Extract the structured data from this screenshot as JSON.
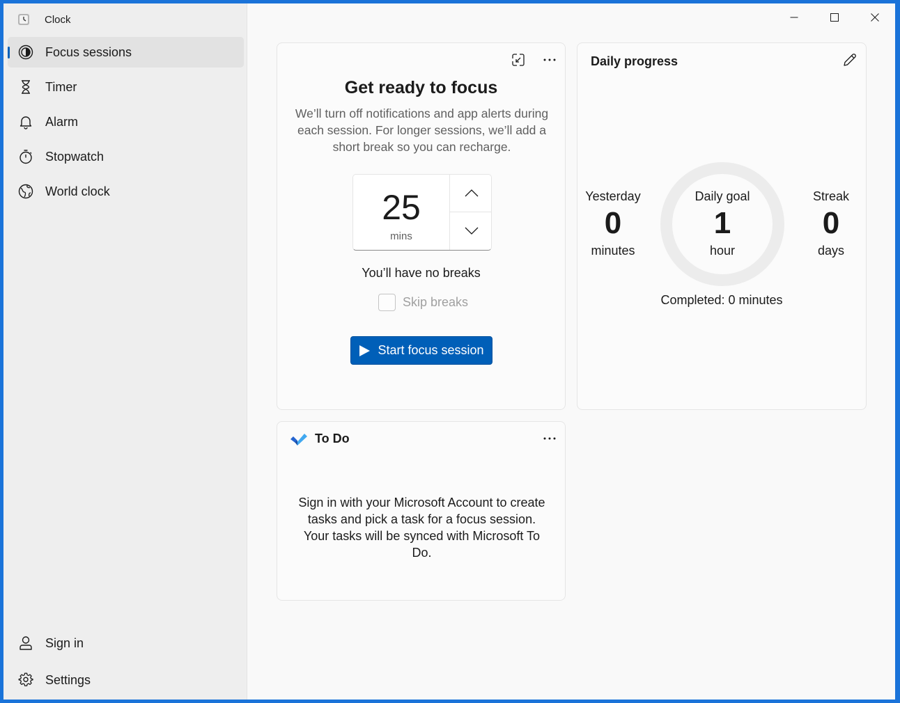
{
  "window": {
    "title": "Clock"
  },
  "sidebar": {
    "items": [
      {
        "label": "Focus sessions",
        "icon": "focus-icon",
        "active": true
      },
      {
        "label": "Timer",
        "icon": "hourglass-icon"
      },
      {
        "label": "Alarm",
        "icon": "bell-icon"
      },
      {
        "label": "Stopwatch",
        "icon": "stopwatch-icon"
      },
      {
        "label": "World clock",
        "icon": "globe-icon"
      }
    ],
    "footer": [
      {
        "label": "Sign in",
        "icon": "person-icon"
      },
      {
        "label": "Settings",
        "icon": "gear-icon"
      }
    ]
  },
  "focus": {
    "title": "Get ready to focus",
    "description": "We’ll turn off notifications and app alerts during each session. For longer sessions, we’ll add a short break so you can recharge.",
    "minutes": "25",
    "unit": "mins",
    "breaks_text": "You’ll have no breaks",
    "skip_label": "Skip breaks",
    "skip_checked": false,
    "start_label": "Start focus session"
  },
  "progress": {
    "title": "Daily progress",
    "yesterday": {
      "label": "Yesterday",
      "value": "0",
      "unit": "minutes"
    },
    "goal": {
      "label": "Daily goal",
      "value": "1",
      "unit": "hour"
    },
    "streak": {
      "label": "Streak",
      "value": "0",
      "unit": "days"
    },
    "completed": "Completed: 0 minutes",
    "goal_fraction": 0
  },
  "todo": {
    "title": "To Do",
    "body": "Sign in with your Microsoft Account to create tasks and pick a task for a focus session. Your tasks will be synced with Microsoft To Do."
  },
  "colors": {
    "accent": "#005fb8",
    "border": "#1a73d9"
  }
}
